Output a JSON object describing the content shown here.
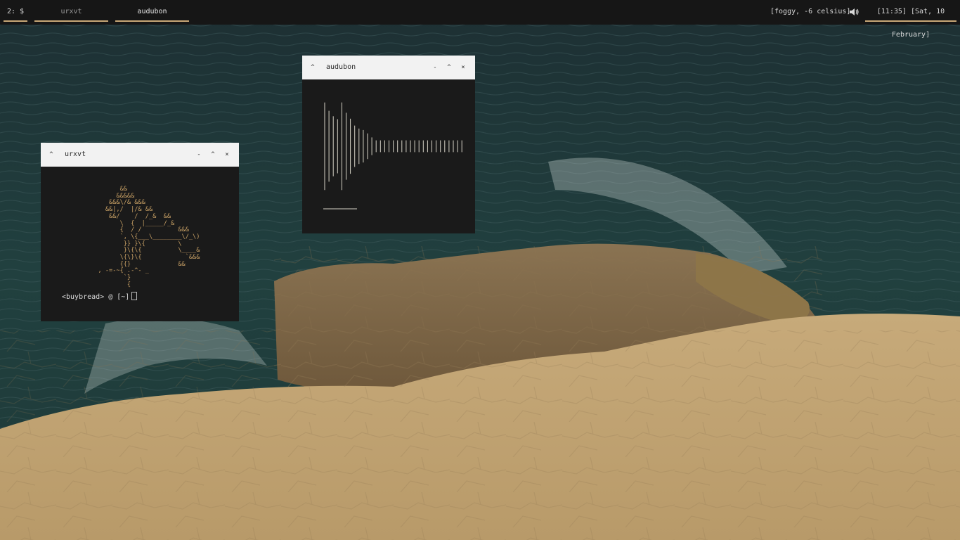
{
  "topbar": {
    "workspaces": [
      {
        "label": "2: $",
        "active": true
      },
      {
        "label": "urxvt",
        "active": false
      },
      {
        "label": "audubon",
        "active": true
      }
    ],
    "weather": "[foggy,  -6 celsius]",
    "volume_icon": "speaker-icon",
    "clock": "[11:35] [Sat, 10 February]",
    "accent_color": "#c9a878"
  },
  "windows": {
    "urxvt": {
      "title": "urxvt",
      "controls": {
        "collapse": "^",
        "minimize": "-",
        "maximize": "^",
        "close": "×"
      },
      "ascii_art": "         &&\n        &&&&&\n      &&&\\/& &&&\n     &&|,/  |/& &&\n      &&/    /  /_&  &&\n         \\  {  |_____/_&\n         {  / /          &&&\n         `, \\{___\\________\\/_\\)\n          }} }\\{         \\\n          }\\{\\{          \\____&\n         \\{\\}\\{            `&&&\n         {{}             &&\n   , -=-~{ .-^- _\n          `}\n           {",
      "prompt": "<buybread> @ [~]"
    },
    "audubon": {
      "title": "audubon",
      "controls": {
        "collapse": "^",
        "minimize": "-",
        "maximize": "^",
        "close": "×"
      }
    }
  },
  "spectrum": {
    "bar_levels": [
      0.89,
      0.72,
      0.61,
      0.55,
      0.89,
      0.68,
      0.56,
      0.42,
      0.36,
      0.33,
      0.26,
      0.18,
      0.12,
      0.12,
      0.12,
      0.12,
      0.12,
      0.12,
      0.12,
      0.12,
      0.12,
      0.12,
      0.12,
      0.12,
      0.12,
      0.12,
      0.12,
      0.12,
      0.12,
      0.12,
      0.12,
      0.12,
      0.12
    ],
    "bar_color": "#d6d2c6"
  },
  "colors": {
    "terminal_bg": "#1a1a1a",
    "titlebar_bg": "#f2f2f2",
    "ascii_color": "#c9a165"
  }
}
